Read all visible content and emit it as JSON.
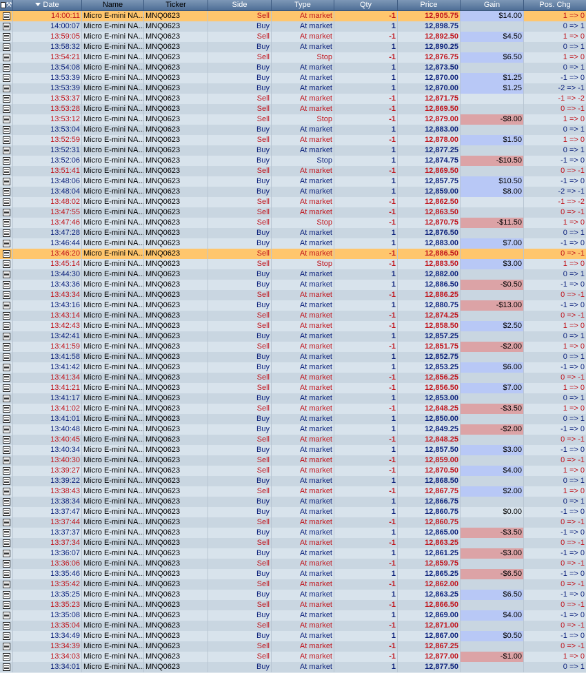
{
  "headers": {
    "date": "Date",
    "name": "Name",
    "ticker": "Ticker",
    "side": "Side",
    "type": "Type",
    "qty": "Qty",
    "price": "Price",
    "gain": "Gain",
    "pos": "Pos. Chg"
  },
  "colors": {
    "buy": "#0a1f7a",
    "sell": "#c0131b",
    "highlight": "#ffc66d",
    "gain_positive": "#b8c8f6",
    "gain_negative": "#dca3a6",
    "header": "#5e7ea4"
  },
  "rows": [
    {
      "date": "14:00:11",
      "name": "Micro E-mini NA...",
      "ticker": "MNQ0623",
      "side": "Sell",
      "type": "At market",
      "qty": "-1",
      "price": "12,905.75",
      "gain": "$14.00",
      "pos": "1 => 0",
      "hl": true
    },
    {
      "date": "14:00:07",
      "name": "Micro E-mini NA...",
      "ticker": "MNQ0623",
      "side": "Buy",
      "type": "At market",
      "qty": "1",
      "price": "12,898.75",
      "gain": "",
      "pos": "0 => 1"
    },
    {
      "date": "13:59:05",
      "name": "Micro E-mini NA...",
      "ticker": "MNQ0623",
      "side": "Sell",
      "type": "At market",
      "qty": "-1",
      "price": "12,892.50",
      "gain": "$4.50",
      "pos": "1 => 0"
    },
    {
      "date": "13:58:32",
      "name": "Micro E-mini NA...",
      "ticker": "MNQ0623",
      "side": "Buy",
      "type": "At market",
      "qty": "1",
      "price": "12,890.25",
      "gain": "",
      "pos": "0 => 1"
    },
    {
      "date": "13:54:21",
      "name": "Micro E-mini NA...",
      "ticker": "MNQ0623",
      "side": "Sell",
      "type": "Stop",
      "qty": "-1",
      "price": "12,876.75",
      "gain": "$6.50",
      "pos": "1 => 0"
    },
    {
      "date": "13:54:08",
      "name": "Micro E-mini NA...",
      "ticker": "MNQ0623",
      "side": "Buy",
      "type": "At market",
      "qty": "1",
      "price": "12,873.50",
      "gain": "",
      "pos": "0 => 1"
    },
    {
      "date": "13:53:39",
      "name": "Micro E-mini NA...",
      "ticker": "MNQ0623",
      "side": "Buy",
      "type": "At market",
      "qty": "1",
      "price": "12,870.00",
      "gain": "$1.25",
      "pos": "-1 => 0"
    },
    {
      "date": "13:53:39",
      "name": "Micro E-mini NA...",
      "ticker": "MNQ0623",
      "side": "Buy",
      "type": "At market",
      "qty": "1",
      "price": "12,870.00",
      "gain": "$1.25",
      "pos": "-2 => -1"
    },
    {
      "date": "13:53:37",
      "name": "Micro E-mini NA...",
      "ticker": "MNQ0623",
      "side": "Sell",
      "type": "At market",
      "qty": "-1",
      "price": "12,871.75",
      "gain": "",
      "pos": "-1 => -2"
    },
    {
      "date": "13:53:28",
      "name": "Micro E-mini NA...",
      "ticker": "MNQ0623",
      "side": "Sell",
      "type": "At market",
      "qty": "-1",
      "price": "12,869.50",
      "gain": "",
      "pos": "0 => -1"
    },
    {
      "date": "13:53:12",
      "name": "Micro E-mini NA...",
      "ticker": "MNQ0623",
      "side": "Sell",
      "type": "Stop",
      "qty": "-1",
      "price": "12,879.00",
      "gain": "-$8.00",
      "pos": "1 => 0"
    },
    {
      "date": "13:53:04",
      "name": "Micro E-mini NA...",
      "ticker": "MNQ0623",
      "side": "Buy",
      "type": "At market",
      "qty": "1",
      "price": "12,883.00",
      "gain": "",
      "pos": "0 => 1"
    },
    {
      "date": "13:52:59",
      "name": "Micro E-mini NA...",
      "ticker": "MNQ0623",
      "side": "Sell",
      "type": "At market",
      "qty": "-1",
      "price": "12,878.00",
      "gain": "$1.50",
      "pos": "1 => 0"
    },
    {
      "date": "13:52:31",
      "name": "Micro E-mini NA...",
      "ticker": "MNQ0623",
      "side": "Buy",
      "type": "At market",
      "qty": "1",
      "price": "12,877.25",
      "gain": "",
      "pos": "0 => 1"
    },
    {
      "date": "13:52:06",
      "name": "Micro E-mini NA...",
      "ticker": "MNQ0623",
      "side": "Buy",
      "type": "Stop",
      "qty": "1",
      "price": "12,874.75",
      "gain": "-$10.50",
      "pos": "-1 => 0"
    },
    {
      "date": "13:51:41",
      "name": "Micro E-mini NA...",
      "ticker": "MNQ0623",
      "side": "Sell",
      "type": "At market",
      "qty": "-1",
      "price": "12,869.50",
      "gain": "",
      "pos": "0 => -1"
    },
    {
      "date": "13:48:06",
      "name": "Micro E-mini NA...",
      "ticker": "MNQ0623",
      "side": "Buy",
      "type": "At market",
      "qty": "1",
      "price": "12,857.75",
      "gain": "$10.50",
      "pos": "-1 => 0"
    },
    {
      "date": "13:48:04",
      "name": "Micro E-mini NA...",
      "ticker": "MNQ0623",
      "side": "Buy",
      "type": "At market",
      "qty": "1",
      "price": "12,859.00",
      "gain": "$8.00",
      "pos": "-2 => -1"
    },
    {
      "date": "13:48:02",
      "name": "Micro E-mini NA...",
      "ticker": "MNQ0623",
      "side": "Sell",
      "type": "At market",
      "qty": "-1",
      "price": "12,862.50",
      "gain": "",
      "pos": "-1 => -2"
    },
    {
      "date": "13:47:55",
      "name": "Micro E-mini NA...",
      "ticker": "MNQ0623",
      "side": "Sell",
      "type": "At market",
      "qty": "-1",
      "price": "12,863.50",
      "gain": "",
      "pos": "0 => -1"
    },
    {
      "date": "13:47:46",
      "name": "Micro E-mini NA...",
      "ticker": "MNQ0623",
      "side": "Sell",
      "type": "Stop",
      "qty": "-1",
      "price": "12,870.75",
      "gain": "-$11.50",
      "pos": "1 => 0"
    },
    {
      "date": "13:47:28",
      "name": "Micro E-mini NA...",
      "ticker": "MNQ0623",
      "side": "Buy",
      "type": "At market",
      "qty": "1",
      "price": "12,876.50",
      "gain": "",
      "pos": "0 => 1"
    },
    {
      "date": "13:46:44",
      "name": "Micro E-mini NA...",
      "ticker": "MNQ0623",
      "side": "Buy",
      "type": "At market",
      "qty": "1",
      "price": "12,883.00",
      "gain": "$7.00",
      "pos": "-1 => 0"
    },
    {
      "date": "13:46:20",
      "name": "Micro E-mini NA...",
      "ticker": "MNQ0623",
      "side": "Sell",
      "type": "At market",
      "qty": "-1",
      "price": "12,886.50",
      "gain": "",
      "pos": "0 => -1",
      "hl": true
    },
    {
      "date": "13:45:14",
      "name": "Micro E-mini NA...",
      "ticker": "MNQ0623",
      "side": "Sell",
      "type": "Stop",
      "qty": "-1",
      "price": "12,883.50",
      "gain": "$3.00",
      "pos": "1 => 0"
    },
    {
      "date": "13:44:30",
      "name": "Micro E-mini NA...",
      "ticker": "MNQ0623",
      "side": "Buy",
      "type": "At market",
      "qty": "1",
      "price": "12,882.00",
      "gain": "",
      "pos": "0 => 1"
    },
    {
      "date": "13:43:36",
      "name": "Micro E-mini NA...",
      "ticker": "MNQ0623",
      "side": "Buy",
      "type": "At market",
      "qty": "1",
      "price": "12,886.50",
      "gain": "-$0.50",
      "pos": "-1 => 0"
    },
    {
      "date": "13:43:34",
      "name": "Micro E-mini NA...",
      "ticker": "MNQ0623",
      "side": "Sell",
      "type": "At market",
      "qty": "-1",
      "price": "12,886.25",
      "gain": "",
      "pos": "0 => -1"
    },
    {
      "date": "13:43:16",
      "name": "Micro E-mini NA...",
      "ticker": "MNQ0623",
      "side": "Buy",
      "type": "At market",
      "qty": "1",
      "price": "12,880.75",
      "gain": "-$13.00",
      "pos": "-1 => 0"
    },
    {
      "date": "13:43:14",
      "name": "Micro E-mini NA...",
      "ticker": "MNQ0623",
      "side": "Sell",
      "type": "At market",
      "qty": "-1",
      "price": "12,874.25",
      "gain": "",
      "pos": "0 => -1"
    },
    {
      "date": "13:42:43",
      "name": "Micro E-mini NA...",
      "ticker": "MNQ0623",
      "side": "Sell",
      "type": "At market",
      "qty": "-1",
      "price": "12,858.50",
      "gain": "$2.50",
      "pos": "1 => 0"
    },
    {
      "date": "13:42:41",
      "name": "Micro E-mini NA...",
      "ticker": "MNQ0623",
      "side": "Buy",
      "type": "At market",
      "qty": "1",
      "price": "12,857.25",
      "gain": "",
      "pos": "0 => 1"
    },
    {
      "date": "13:41:59",
      "name": "Micro E-mini NA...",
      "ticker": "MNQ0623",
      "side": "Sell",
      "type": "At market",
      "qty": "-1",
      "price": "12,851.75",
      "gain": "-$2.00",
      "pos": "1 => 0"
    },
    {
      "date": "13:41:58",
      "name": "Micro E-mini NA...",
      "ticker": "MNQ0623",
      "side": "Buy",
      "type": "At market",
      "qty": "1",
      "price": "12,852.75",
      "gain": "",
      "pos": "0 => 1"
    },
    {
      "date": "13:41:42",
      "name": "Micro E-mini NA...",
      "ticker": "MNQ0623",
      "side": "Buy",
      "type": "At market",
      "qty": "1",
      "price": "12,853.25",
      "gain": "$6.00",
      "pos": "-1 => 0"
    },
    {
      "date": "13:41:34",
      "name": "Micro E-mini NA...",
      "ticker": "MNQ0623",
      "side": "Sell",
      "type": "At market",
      "qty": "-1",
      "price": "12,856.25",
      "gain": "",
      "pos": "0 => -1"
    },
    {
      "date": "13:41:21",
      "name": "Micro E-mini NA...",
      "ticker": "MNQ0623",
      "side": "Sell",
      "type": "At market",
      "qty": "-1",
      "price": "12,856.50",
      "gain": "$7.00",
      "pos": "1 => 0"
    },
    {
      "date": "13:41:17",
      "name": "Micro E-mini NA...",
      "ticker": "MNQ0623",
      "side": "Buy",
      "type": "At market",
      "qty": "1",
      "price": "12,853.00",
      "gain": "",
      "pos": "0 => 1"
    },
    {
      "date": "13:41:02",
      "name": "Micro E-mini NA...",
      "ticker": "MNQ0623",
      "side": "Sell",
      "type": "At market",
      "qty": "-1",
      "price": "12,848.25",
      "gain": "-$3.50",
      "pos": "1 => 0"
    },
    {
      "date": "13:41:01",
      "name": "Micro E-mini NA...",
      "ticker": "MNQ0623",
      "side": "Buy",
      "type": "At market",
      "qty": "1",
      "price": "12,850.00",
      "gain": "",
      "pos": "0 => 1"
    },
    {
      "date": "13:40:48",
      "name": "Micro E-mini NA...",
      "ticker": "MNQ0623",
      "side": "Buy",
      "type": "At market",
      "qty": "1",
      "price": "12,849.25",
      "gain": "-$2.00",
      "pos": "-1 => 0"
    },
    {
      "date": "13:40:45",
      "name": "Micro E-mini NA...",
      "ticker": "MNQ0623",
      "side": "Sell",
      "type": "At market",
      "qty": "-1",
      "price": "12,848.25",
      "gain": "",
      "pos": "0 => -1"
    },
    {
      "date": "13:40:34",
      "name": "Micro E-mini NA...",
      "ticker": "MNQ0623",
      "side": "Buy",
      "type": "At market",
      "qty": "1",
      "price": "12,857.50",
      "gain": "$3.00",
      "pos": "-1 => 0"
    },
    {
      "date": "13:40:30",
      "name": "Micro E-mini NA...",
      "ticker": "MNQ0623",
      "side": "Sell",
      "type": "At market",
      "qty": "-1",
      "price": "12,859.00",
      "gain": "",
      "pos": "0 => -1"
    },
    {
      "date": "13:39:27",
      "name": "Micro E-mini NA...",
      "ticker": "MNQ0623",
      "side": "Sell",
      "type": "At market",
      "qty": "-1",
      "price": "12,870.50",
      "gain": "$4.00",
      "pos": "1 => 0"
    },
    {
      "date": "13:39:22",
      "name": "Micro E-mini NA...",
      "ticker": "MNQ0623",
      "side": "Buy",
      "type": "At market",
      "qty": "1",
      "price": "12,868.50",
      "gain": "",
      "pos": "0 => 1"
    },
    {
      "date": "13:38:43",
      "name": "Micro E-mini NA...",
      "ticker": "MNQ0623",
      "side": "Sell",
      "type": "At market",
      "qty": "-1",
      "price": "12,867.75",
      "gain": "$2.00",
      "pos": "1 => 0"
    },
    {
      "date": "13:38:34",
      "name": "Micro E-mini NA...",
      "ticker": "MNQ0623",
      "side": "Buy",
      "type": "At market",
      "qty": "1",
      "price": "12,866.75",
      "gain": "",
      "pos": "0 => 1"
    },
    {
      "date": "13:37:47",
      "name": "Micro E-mini NA...",
      "ticker": "MNQ0623",
      "side": "Buy",
      "type": "At market",
      "qty": "1",
      "price": "12,860.75",
      "gain": "$0.00",
      "pos": "-1 => 0"
    },
    {
      "date": "13:37:44",
      "name": "Micro E-mini NA...",
      "ticker": "MNQ0623",
      "side": "Sell",
      "type": "At market",
      "qty": "-1",
      "price": "12,860.75",
      "gain": "",
      "pos": "0 => -1"
    },
    {
      "date": "13:37:37",
      "name": "Micro E-mini NA...",
      "ticker": "MNQ0623",
      "side": "Buy",
      "type": "At market",
      "qty": "1",
      "price": "12,865.00",
      "gain": "-$3.50",
      "pos": "-1 => 0"
    },
    {
      "date": "13:37:34",
      "name": "Micro E-mini NA...",
      "ticker": "MNQ0623",
      "side": "Sell",
      "type": "At market",
      "qty": "-1",
      "price": "12,863.25",
      "gain": "",
      "pos": "0 => -1"
    },
    {
      "date": "13:36:07",
      "name": "Micro E-mini NA...",
      "ticker": "MNQ0623",
      "side": "Buy",
      "type": "At market",
      "qty": "1",
      "price": "12,861.25",
      "gain": "-$3.00",
      "pos": "-1 => 0"
    },
    {
      "date": "13:36:06",
      "name": "Micro E-mini NA...",
      "ticker": "MNQ0623",
      "side": "Sell",
      "type": "At market",
      "qty": "-1",
      "price": "12,859.75",
      "gain": "",
      "pos": "0 => -1"
    },
    {
      "date": "13:35:46",
      "name": "Micro E-mini NA...",
      "ticker": "MNQ0623",
      "side": "Buy",
      "type": "At market",
      "qty": "1",
      "price": "12,865.25",
      "gain": "-$6.50",
      "pos": "-1 => 0"
    },
    {
      "date": "13:35:42",
      "name": "Micro E-mini NA...",
      "ticker": "MNQ0623",
      "side": "Sell",
      "type": "At market",
      "qty": "-1",
      "price": "12,862.00",
      "gain": "",
      "pos": "0 => -1"
    },
    {
      "date": "13:35:25",
      "name": "Micro E-mini NA...",
      "ticker": "MNQ0623",
      "side": "Buy",
      "type": "At market",
      "qty": "1",
      "price": "12,863.25",
      "gain": "$6.50",
      "pos": "-1 => 0"
    },
    {
      "date": "13:35:23",
      "name": "Micro E-mini NA...",
      "ticker": "MNQ0623",
      "side": "Sell",
      "type": "At market",
      "qty": "-1",
      "price": "12,866.50",
      "gain": "",
      "pos": "0 => -1"
    },
    {
      "date": "13:35:08",
      "name": "Micro E-mini NA...",
      "ticker": "MNQ0623",
      "side": "Buy",
      "type": "At market",
      "qty": "1",
      "price": "12,869.00",
      "gain": "$4.00",
      "pos": "-1 => 0"
    },
    {
      "date": "13:35:04",
      "name": "Micro E-mini NA...",
      "ticker": "MNQ0623",
      "side": "Sell",
      "type": "At market",
      "qty": "-1",
      "price": "12,871.00",
      "gain": "",
      "pos": "0 => -1"
    },
    {
      "date": "13:34:49",
      "name": "Micro E-mini NA...",
      "ticker": "MNQ0623",
      "side": "Buy",
      "type": "At market",
      "qty": "1",
      "price": "12,867.00",
      "gain": "$0.50",
      "pos": "-1 => 0"
    },
    {
      "date": "13:34:39",
      "name": "Micro E-mini NA...",
      "ticker": "MNQ0623",
      "side": "Sell",
      "type": "At market",
      "qty": "-1",
      "price": "12,867.25",
      "gain": "",
      "pos": "0 => -1"
    },
    {
      "date": "13:34:03",
      "name": "Micro E-mini NA...",
      "ticker": "MNQ0623",
      "side": "Sell",
      "type": "At market",
      "qty": "-1",
      "price": "12,877.00",
      "gain": "-$1.00",
      "pos": "1 => 0"
    },
    {
      "date": "13:34:01",
      "name": "Micro E-mini NA...",
      "ticker": "MNQ0623",
      "side": "Buy",
      "type": "At market",
      "qty": "1",
      "price": "12,877.50",
      "gain": "",
      "pos": "0 => 1"
    }
  ]
}
